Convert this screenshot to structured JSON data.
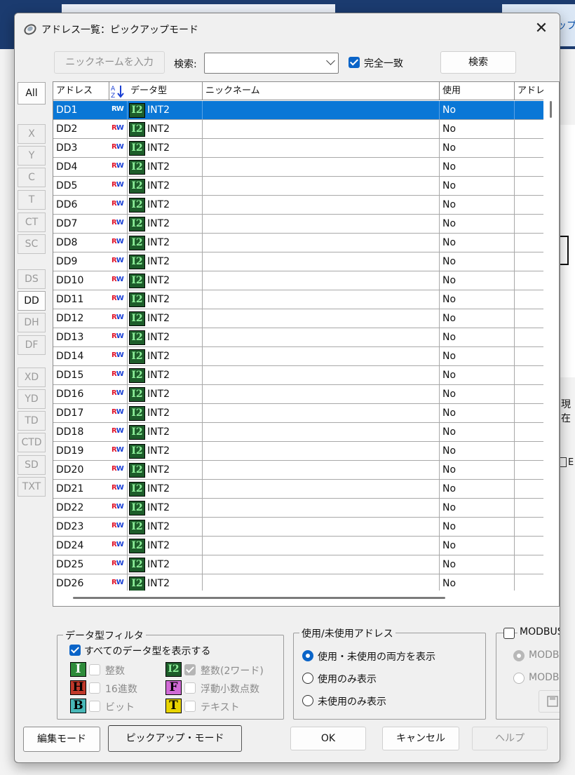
{
  "background": {
    "tab_right_label": "ップ",
    "right_text": "現在",
    "right_chk_label": "E"
  },
  "dialog": {
    "title": "アドレス一覧：ピックアップモード",
    "close_label": "✕"
  },
  "toolbar": {
    "nickname_button": "ニックネームを入力",
    "search_label": "検索:",
    "search_value": "",
    "exact_match_label": "完全一致",
    "exact_match_checked": true,
    "search_button": "検索"
  },
  "side_filters": [
    "All",
    "X",
    "Y",
    "C",
    "T",
    "CT",
    "SC",
    "DS",
    "DD",
    "DH",
    "DF",
    "XD",
    "YD",
    "TD",
    "CTD",
    "SD",
    "TXT"
  ],
  "grid": {
    "columns": [
      "アドレス",
      "データ型",
      "ニックネーム",
      "使用",
      "アドレ"
    ],
    "sort_icon": "A-Z sort",
    "rw_r": "R",
    "rw_w": "W",
    "type_icon": "I2",
    "rows": [
      {
        "address": "DD1",
        "type": "INT2",
        "nickname": "",
        "used": "No"
      },
      {
        "address": "DD2",
        "type": "INT2",
        "nickname": "",
        "used": "No"
      },
      {
        "address": "DD3",
        "type": "INT2",
        "nickname": "",
        "used": "No"
      },
      {
        "address": "DD4",
        "type": "INT2",
        "nickname": "",
        "used": "No"
      },
      {
        "address": "DD5",
        "type": "INT2",
        "nickname": "",
        "used": "No"
      },
      {
        "address": "DD6",
        "type": "INT2",
        "nickname": "",
        "used": "No"
      },
      {
        "address": "DD7",
        "type": "INT2",
        "nickname": "",
        "used": "No"
      },
      {
        "address": "DD8",
        "type": "INT2",
        "nickname": "",
        "used": "No"
      },
      {
        "address": "DD9",
        "type": "INT2",
        "nickname": "",
        "used": "No"
      },
      {
        "address": "DD10",
        "type": "INT2",
        "nickname": "",
        "used": "No"
      },
      {
        "address": "DD11",
        "type": "INT2",
        "nickname": "",
        "used": "No"
      },
      {
        "address": "DD12",
        "type": "INT2",
        "nickname": "",
        "used": "No"
      },
      {
        "address": "DD13",
        "type": "INT2",
        "nickname": "",
        "used": "No"
      },
      {
        "address": "DD14",
        "type": "INT2",
        "nickname": "",
        "used": "No"
      },
      {
        "address": "DD15",
        "type": "INT2",
        "nickname": "",
        "used": "No"
      },
      {
        "address": "DD16",
        "type": "INT2",
        "nickname": "",
        "used": "No"
      },
      {
        "address": "DD17",
        "type": "INT2",
        "nickname": "",
        "used": "No"
      },
      {
        "address": "DD18",
        "type": "INT2",
        "nickname": "",
        "used": "No"
      },
      {
        "address": "DD19",
        "type": "INT2",
        "nickname": "",
        "used": "No"
      },
      {
        "address": "DD20",
        "type": "INT2",
        "nickname": "",
        "used": "No"
      },
      {
        "address": "DD21",
        "type": "INT2",
        "nickname": "",
        "used": "No"
      },
      {
        "address": "DD22",
        "type": "INT2",
        "nickname": "",
        "used": "No"
      },
      {
        "address": "DD23",
        "type": "INT2",
        "nickname": "",
        "used": "No"
      },
      {
        "address": "DD24",
        "type": "INT2",
        "nickname": "",
        "used": "No"
      },
      {
        "address": "DD25",
        "type": "INT2",
        "nickname": "",
        "used": "No"
      },
      {
        "address": "DD26",
        "type": "INT2",
        "nickname": "",
        "used": "No"
      }
    ]
  },
  "datatype_filter": {
    "title": "データ型フィルタ",
    "show_all_label": "すべてのデータ型を表示する",
    "types": [
      {
        "icon": "I",
        "label": "整数",
        "color": "#2e8b3a"
      },
      {
        "icon": "I2",
        "label": "整数(2ワード)",
        "color": "#1d5c2a"
      },
      {
        "icon": "H",
        "label": "16進数",
        "color": "#c0392b"
      },
      {
        "icon": "F",
        "label": "浮動小数点数",
        "color": "#d16ad6"
      },
      {
        "icon": "B",
        "label": "ビット",
        "color": "#48b8b8"
      },
      {
        "icon": "T",
        "label": "テキスト",
        "color": "#e8d400"
      }
    ]
  },
  "usage_filter": {
    "title": "使用/未使用アドレス",
    "options": [
      "使用・未使用の両方を表示",
      "使用のみ表示",
      "未使用のみ表示"
    ],
    "selected": 0
  },
  "modbus": {
    "title": "MODBUS",
    "options": [
      "MODBUS",
      "MODBUS"
    ]
  },
  "footer": {
    "edit_mode": "編集モード",
    "pickup_mode": "ピックアップ・モード",
    "ok": "OK",
    "cancel": "キャンセル",
    "help": "ヘルプ"
  }
}
